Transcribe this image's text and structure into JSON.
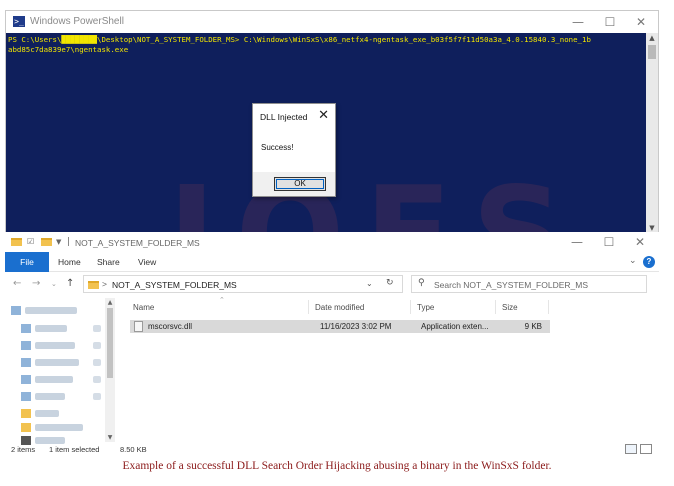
{
  "powershell": {
    "title": "Windows PowerShell",
    "console_lines": [
      "PS C:\\Users\\████████\\Desktop\\NOT_A_SYSTEM_FOLDER_MS> C:\\Windows\\WinSxS\\x86_netfx4-ngentask_exe_b03f5f7f11d50a3a_4.0.15840.3_none_1b",
      "abd85c7da839e7\\ngentask.exe"
    ],
    "controls": {
      "minimize": "—",
      "maximize": "☐",
      "close": "✕"
    }
  },
  "dialog": {
    "title": "DLL Injected",
    "close": "✕",
    "message": "Success!",
    "ok_label": "OK"
  },
  "watermark": "JOES",
  "explorer": {
    "title": "NOT_A_SYSTEM_FOLDER_MS",
    "controls": {
      "minimize": "—",
      "maximize": "☐",
      "close": "✕"
    },
    "ribbon": {
      "file": "File",
      "home": "Home",
      "share": "Share",
      "view": "View"
    },
    "address": {
      "path": "NOT_A_SYSTEM_FOLDER_MS",
      "separator": ">"
    },
    "search": {
      "placeholder": "Search NOT_A_SYSTEM_FOLDER_MS"
    },
    "columns": {
      "name": "Name",
      "date": "Date modified",
      "type": "Type",
      "size": "Size"
    },
    "files": [
      {
        "name": "mscorsvc.dll",
        "date": "11/16/2023 3:02 PM",
        "type": "Application exten...",
        "size": "9 KB"
      }
    ],
    "status": {
      "items": "2 items",
      "selected": "1 item selected",
      "size": "8.50 KB"
    }
  },
  "caption": "Example of a successful DLL Search Order Hijacking abusing a binary in the WinSxS folder."
}
